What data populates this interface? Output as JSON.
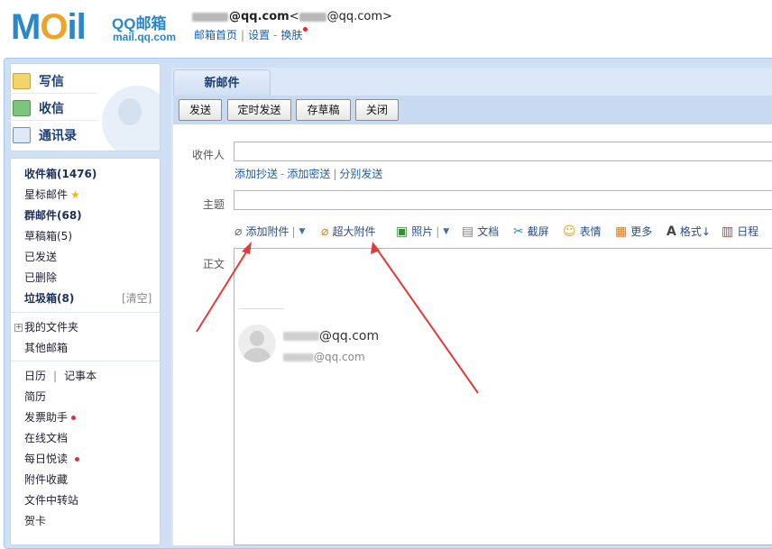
{
  "header": {
    "logo_text": "MOil",
    "brand": "QQ邮箱",
    "domain": "mail.qq.com",
    "account_email": "@qq.com",
    "account_alias_prefix": "<",
    "account_alias": "@qq.com>",
    "links": [
      "邮箱首页",
      "设置",
      "换肤"
    ]
  },
  "sidebar": {
    "actions": [
      {
        "label": "写信",
        "icon": "write-icon"
      },
      {
        "label": "收信",
        "icon": "inbox-download-icon"
      },
      {
        "label": "通讯录",
        "icon": "contacts-icon"
      }
    ],
    "folders": [
      {
        "label": "收件箱(1476)",
        "bold": true
      },
      {
        "label": "星标邮件",
        "star": true
      },
      {
        "label": "群邮件(68)",
        "bold": true
      },
      {
        "label": "草稿箱(5)"
      },
      {
        "label": "已发送"
      },
      {
        "label": "已删除"
      },
      {
        "label": "垃圾箱(8)",
        "bold": true
      }
    ],
    "clear_label": "[清空]",
    "my_folders": "我的文件夹",
    "other_mailbox": "其他邮箱",
    "calendar": "日历",
    "notes": "记事本",
    "apps": [
      "简历",
      "发票助手",
      "在线文档",
      "每日悦读",
      "附件收藏",
      "文件中转站",
      "贺卡"
    ]
  },
  "compose": {
    "tab_title": "新邮件",
    "buttons": [
      "发送",
      "定时发送",
      "存草稿",
      "关闭"
    ],
    "to_label": "收件人",
    "to_value": "",
    "cc_links": [
      "添加抄送",
      "添加密送",
      "分别发送"
    ],
    "subject_label": "主题",
    "subject_value": "",
    "body_label": "正文",
    "toolbar": [
      "添加附件",
      "超大附件",
      "照片",
      "文档",
      "截屏",
      "表情",
      "更多",
      "格式↓",
      "日程"
    ],
    "signature_email": "@qq.com",
    "signature_email2": "@qq.com"
  },
  "colors": {
    "frame": "#cfe0f4",
    "link": "#1d5fa8",
    "annotation_arrow": "#e23a3a"
  }
}
